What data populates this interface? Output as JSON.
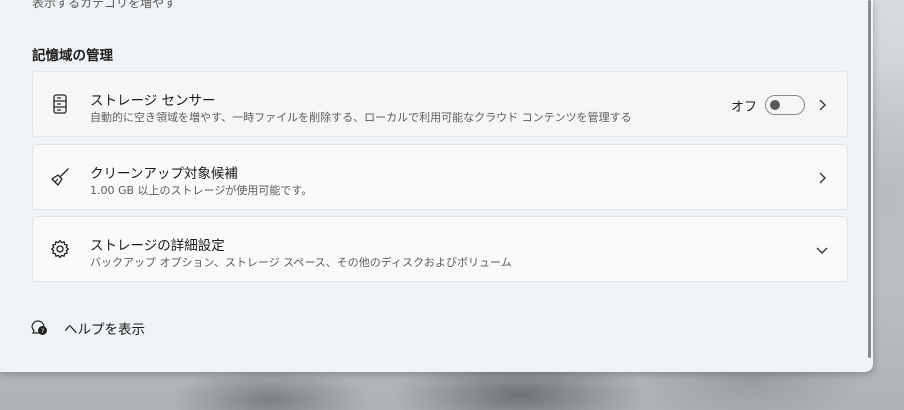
{
  "top_partial_text": "表示するカテゴリを増やす",
  "section": {
    "title": "記憶域の管理"
  },
  "cards": [
    {
      "title": "ストレージ センサー",
      "description": "自動的に空き領域を増やす、一時ファイルを削除する、ローカルで利用可能なクラウド コンテンツを管理する",
      "icon": "storage-drive-icon",
      "toggle": {
        "label": "オフ",
        "state": "off"
      },
      "action_icon": "chevron-right-icon"
    },
    {
      "title": "クリーンアップ対象候補",
      "description": "1.00 GB 以上のストレージが使用可能です。",
      "icon": "broom-icon",
      "action_icon": "chevron-right-icon"
    },
    {
      "title": "ストレージの詳細設定",
      "description": "バックアップ オプション、ストレージ スペース、その他のディスクおよびボリューム",
      "icon": "gear-icon",
      "action_icon": "chevron-down-icon"
    }
  ],
  "help": {
    "label": "ヘルプを表示",
    "icon": "help-chat-icon"
  }
}
